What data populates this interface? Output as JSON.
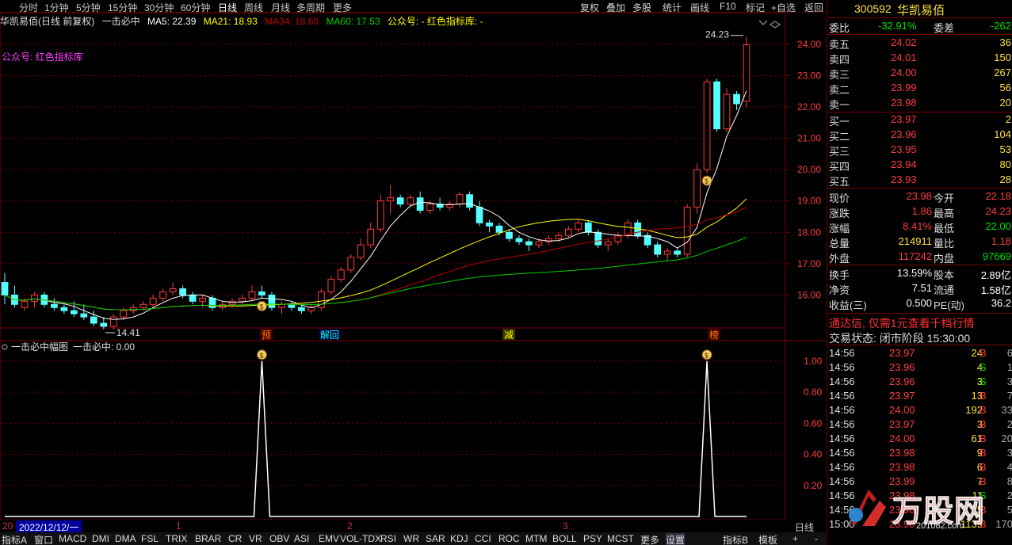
{
  "period_tabs": [
    "分时",
    "1分钟",
    "5分钟",
    "15分钟",
    "30分钟",
    "60分钟",
    "日线",
    "周线",
    "月线",
    "多周期",
    "更多"
  ],
  "selected_period": "日线",
  "tool_buttons": [
    "复权",
    "叠加",
    "多股",
    "统计",
    "画线",
    "F10",
    "标记",
    "+自选",
    "返回"
  ],
  "main_info": {
    "title": "华凯易佰(日线 前复权)",
    "indicator": "一击必中",
    "ma5": "MA5: 22.39",
    "ma21": "MA21: 18.93",
    "ma34": "MA34: 18.60",
    "ma60": "MA60: 17.53",
    "gzh": "公众号: - 红色指标库: -"
  },
  "chart_note": "公众号: 红色指标库",
  "price_axis": [
    "24.00",
    "23.00",
    "22.00",
    "21.00",
    "20.00",
    "19.00",
    "18.00",
    "17.00",
    "16.00"
  ],
  "high_label": "24.23",
  "low_label": "14.41",
  "event_tags": [
    "预",
    "解回",
    "减",
    "榜"
  ],
  "sub_info": {
    "title": "一击必中幅图",
    "value": "一击必中: 0.00"
  },
  "sub_axis": [
    "1.00",
    "0.80",
    "0.60",
    "0.40",
    "0.20"
  ],
  "date_bar": {
    "left": "20",
    "date": "2022/12/12/一",
    "m1": "1",
    "m2": "2",
    "m3": "3",
    "period": "日线"
  },
  "bottom_tabs": [
    "指标A",
    "窗口",
    "MACD",
    "DMI",
    "DMA",
    "FSL",
    "TRIX",
    "BRAR",
    "CR",
    "VR",
    "OBV",
    "ASI",
    "EMV",
    "VOL-TDX",
    "RSI",
    "WR",
    "SAR",
    "KDJ",
    "CCI",
    "ROC",
    "MTM",
    "BOLL",
    "PSY",
    "MCST",
    "更多",
    "设置",
    "指标B",
    "模板"
  ],
  "bottom_extra": [
    "+",
    "-"
  ],
  "stock": {
    "code": "300592",
    "name": "华凯易佰"
  },
  "weibi": {
    "label": "委比",
    "value": "-32.91%",
    "label2": "委差",
    "value2": "-262"
  },
  "sells": [
    {
      "label": "卖五",
      "price": "24.02",
      "vol": "36"
    },
    {
      "label": "卖四",
      "price": "24.01",
      "vol": "150"
    },
    {
      "label": "卖三",
      "price": "24.00",
      "vol": "267"
    },
    {
      "label": "卖二",
      "price": "23.99",
      "vol": "56"
    },
    {
      "label": "卖一",
      "price": "23.98",
      "vol": "20"
    }
  ],
  "buys": [
    {
      "label": "买一",
      "price": "23.97",
      "vol": "2"
    },
    {
      "label": "买二",
      "price": "23.96",
      "vol": "104"
    },
    {
      "label": "买三",
      "price": "23.95",
      "vol": "53"
    },
    {
      "label": "买四",
      "price": "23.94",
      "vol": "80"
    },
    {
      "label": "买五",
      "price": "23.93",
      "vol": "28"
    }
  ],
  "quote": [
    {
      "l1": "现价",
      "v1": "23.98",
      "c1": "red",
      "l2": "今开",
      "v2": "22.18",
      "c2": "red"
    },
    {
      "l1": "涨跌",
      "v1": "1.86",
      "c1": "red",
      "l2": "最高",
      "v2": "24.23",
      "c2": "red"
    },
    {
      "l1": "涨幅",
      "v1": "8.41%",
      "c1": "red",
      "l2": "最低",
      "v2": "22.00",
      "c2": "green"
    },
    {
      "l1": "总量",
      "v1": "214911",
      "c1": "yellow",
      "l2": "量比",
      "v2": "1.18",
      "c2": "red"
    },
    {
      "l1": "外盘",
      "v1": "117242",
      "c1": "red",
      "l2": "内盘",
      "v2": "97669",
      "c2": "green"
    }
  ],
  "fund": [
    {
      "l1": "换手",
      "v1": "13.59%",
      "l2": "股本",
      "v2": "2.89亿"
    },
    {
      "l1": "净资",
      "v1": "7.51",
      "l2": "流通",
      "v2": "1.58亿"
    },
    {
      "l1": "收益(三)",
      "v1": "0.500",
      "l2": "PE(动)",
      "v2": "36.2"
    }
  ],
  "ad": "通达信, 仅需1元查看千档行情",
  "trade_state": "交易状态: 闭市阶段 15:30:00",
  "ticks": [
    {
      "t": "14:56",
      "p": "23.97",
      "v": "24",
      "d": "B",
      "n": "6"
    },
    {
      "t": "14:56",
      "p": "23.96",
      "v": "4",
      "d": "S",
      "n": "1"
    },
    {
      "t": "14:56",
      "p": "23.96",
      "v": "3",
      "d": "S",
      "n": "3"
    },
    {
      "t": "14:56",
      "p": "23.97",
      "v": "13",
      "d": "B",
      "n": "7"
    },
    {
      "t": "14:56",
      "p": "24.00",
      "v": "192",
      "d": "B",
      "n": "33"
    },
    {
      "t": "14:56",
      "p": "23.97",
      "v": "3",
      "d": "B",
      "n": "2"
    },
    {
      "t": "14:56",
      "p": "24.00",
      "v": "61",
      "d": "B",
      "n": "20"
    },
    {
      "t": "14:56",
      "p": "23.98",
      "v": "9",
      "d": "B",
      "n": "3"
    },
    {
      "t": "14:56",
      "p": "23.98",
      "v": "6",
      "d": "B",
      "n": "4"
    },
    {
      "t": "14:56",
      "p": "23.99",
      "v": "7",
      "d": "B",
      "n": "8"
    },
    {
      "t": "14:56",
      "p": "23.98",
      "v": "11",
      "d": "S",
      "n": "2"
    },
    {
      "t": "14:56",
      "p": "23.98",
      "v": "5",
      "d": "B",
      "n": "5"
    },
    {
      "t": "15:00",
      "p": "23.98",
      "v": "1139",
      "d": "B",
      "n": "170"
    }
  ],
  "watermark": "万股网",
  "watermark_sub": "201082.com",
  "colors": {
    "bg": "#000000",
    "up": "#ff3c3c",
    "down": "#54ffff",
    "ma5": "#ffffff",
    "ma21": "#ffff00",
    "ma34": "#c00000",
    "ma60": "#00d000",
    "grid": "#7a0000"
  },
  "chart_data": {
    "type": "candlestick",
    "price_range": [
      15.0,
      24.5
    ],
    "candles": [
      [
        16.4,
        16.7,
        15.7,
        16.0
      ],
      [
        16.0,
        16.3,
        15.6,
        15.7
      ],
      [
        15.6,
        15.9,
        15.5,
        15.8
      ],
      [
        15.8,
        16.1,
        15.6,
        16.0
      ],
      [
        16.0,
        16.1,
        15.6,
        15.7
      ],
      [
        15.7,
        15.9,
        15.5,
        15.6
      ],
      [
        15.6,
        15.7,
        15.4,
        15.5
      ],
      [
        15.5,
        15.8,
        15.3,
        15.4
      ],
      [
        15.4,
        15.7,
        15.2,
        15.3
      ],
      [
        15.3,
        15.5,
        15.0,
        15.1
      ],
      [
        15.1,
        15.3,
        14.9,
        15.0
      ],
      [
        15.0,
        15.4,
        14.9,
        15.3
      ],
      [
        15.3,
        15.6,
        15.2,
        15.5
      ],
      [
        15.5,
        15.7,
        15.4,
        15.6
      ],
      [
        15.6,
        15.8,
        15.5,
        15.7
      ],
      [
        15.7,
        16.0,
        15.6,
        15.9
      ],
      [
        15.9,
        16.2,
        15.8,
        16.1
      ],
      [
        16.1,
        16.4,
        16.0,
        16.2
      ],
      [
        16.2,
        16.3,
        15.9,
        16.0
      ],
      [
        16.0,
        16.1,
        15.7,
        15.8
      ],
      [
        15.8,
        16.0,
        15.6,
        15.9
      ],
      [
        15.9,
        16.0,
        15.5,
        15.6
      ],
      [
        15.6,
        15.8,
        15.5,
        15.7
      ],
      [
        15.7,
        15.9,
        15.6,
        15.8
      ],
      [
        15.8,
        16.0,
        15.7,
        15.9
      ],
      [
        15.9,
        16.3,
        15.8,
        16.1
      ],
      [
        16.1,
        16.3,
        15.9,
        16.0
      ],
      [
        16.0,
        16.1,
        15.5,
        15.6
      ],
      [
        15.6,
        15.8,
        15.4,
        15.7
      ],
      [
        15.7,
        15.8,
        15.5,
        15.6
      ],
      [
        15.6,
        15.7,
        15.4,
        15.5
      ],
      [
        15.5,
        15.7,
        15.4,
        15.6
      ],
      [
        15.6,
        16.2,
        15.5,
        16.1
      ],
      [
        16.1,
        16.6,
        16.0,
        16.5
      ],
      [
        16.5,
        16.9,
        16.4,
        16.8
      ],
      [
        16.8,
        17.3,
        16.7,
        17.2
      ],
      [
        17.2,
        17.8,
        17.1,
        17.6
      ],
      [
        17.6,
        18.3,
        17.5,
        18.1
      ],
      [
        18.1,
        19.2,
        18.0,
        19.0
      ],
      [
        19.0,
        19.5,
        18.6,
        19.1
      ],
      [
        19.1,
        19.2,
        18.8,
        18.9
      ],
      [
        18.9,
        19.2,
        18.8,
        19.1
      ],
      [
        19.1,
        19.3,
        18.6,
        18.7
      ],
      [
        18.7,
        19.0,
        18.6,
        18.9
      ],
      [
        18.9,
        19.1,
        18.7,
        18.8
      ],
      [
        18.8,
        19.0,
        18.7,
        18.9
      ],
      [
        18.9,
        19.3,
        18.8,
        19.2
      ],
      [
        19.2,
        19.3,
        18.7,
        18.8
      ],
      [
        18.8,
        19.0,
        18.2,
        18.3
      ],
      [
        18.3,
        18.4,
        18.0,
        18.2
      ],
      [
        18.2,
        18.3,
        17.9,
        18.0
      ],
      [
        18.0,
        18.1,
        17.7,
        17.8
      ],
      [
        17.8,
        17.9,
        17.6,
        17.7
      ],
      [
        17.7,
        17.8,
        17.4,
        17.6
      ],
      [
        17.6,
        17.8,
        17.5,
        17.7
      ],
      [
        17.7,
        17.9,
        17.6,
        17.8
      ],
      [
        17.8,
        18.0,
        17.7,
        17.9
      ],
      [
        17.9,
        18.2,
        17.8,
        18.1
      ],
      [
        18.1,
        18.4,
        18.0,
        18.3
      ],
      [
        18.3,
        18.4,
        17.9,
        18.0
      ],
      [
        18.0,
        18.1,
        17.5,
        17.6
      ],
      [
        17.6,
        17.8,
        17.4,
        17.7
      ],
      [
        17.7,
        18.0,
        17.6,
        17.9
      ],
      [
        17.9,
        18.4,
        17.8,
        18.3
      ],
      [
        18.3,
        18.4,
        17.8,
        17.9
      ],
      [
        17.9,
        18.0,
        17.5,
        17.6
      ],
      [
        17.6,
        17.7,
        17.2,
        17.3
      ],
      [
        17.3,
        17.5,
        17.1,
        17.4
      ],
      [
        17.4,
        17.5,
        17.2,
        17.3
      ],
      [
        17.3,
        18.9,
        17.2,
        18.8
      ],
      [
        18.8,
        20.2,
        18.6,
        20.0
      ],
      [
        20.0,
        22.9,
        19.9,
        22.8
      ],
      [
        22.8,
        22.9,
        21.2,
        21.3
      ],
      [
        21.3,
        22.6,
        21.2,
        22.4
      ],
      [
        22.4,
        22.5,
        21.9,
        22.1
      ],
      [
        22.18,
        24.23,
        22.0,
        23.98
      ]
    ],
    "ma_series": [
      "MA5",
      "MA21",
      "MA34",
      "MA60"
    ],
    "ma_values": {
      "MA5": 22.39,
      "MA21": 18.93,
      "MA34": 18.6,
      "MA60": 17.53
    },
    "signals_at": [
      26,
      71
    ],
    "sub_signal": {
      "range": [
        0,
        1.05
      ],
      "pulse_at": [
        26,
        71
      ],
      "peak": 1.0
    }
  }
}
